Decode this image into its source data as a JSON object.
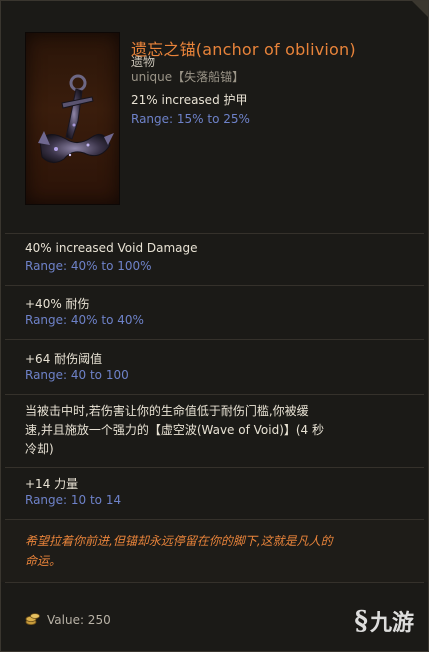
{
  "item": {
    "name": "遗忘之锚(anchor of oblivion)",
    "type": "遗物",
    "rarity": "unique【失落船锚】",
    "implicit": {
      "text": "21% increased 护甲",
      "range": "Range: 15% to 25%"
    }
  },
  "affixes": [
    {
      "text": "40% increased Void Damage",
      "range": "Range: 40% to 100%"
    },
    {
      "text": "+40% 耐伤",
      "range": "Range: 40% to 40%"
    },
    {
      "text": "+64 耐伤阈值",
      "range": "Range: 40 to 100"
    }
  ],
  "special": {
    "line1": "当被击中时,若伤害让你的生命值低于耐伤门槛,你被缓",
    "line2": "速,并且施放一个强力的【虚空波(Wave of Void)】(4 秒",
    "line3": "冷却)"
  },
  "strength": {
    "text": "+14 力量",
    "range": "Range: 10 to 14"
  },
  "lore": {
    "line1": "希望拉着你前进,但锚却永远停留在你的脚下,这就是凡人的",
    "line2": "命运。"
  },
  "footer": {
    "value": "Value: 250"
  },
  "watermark": {
    "text": "九游"
  },
  "colors": {
    "title": "#e8833a",
    "range": "#6e82c9",
    "text": "#e8e2d4",
    "background": "#1b1a17"
  }
}
